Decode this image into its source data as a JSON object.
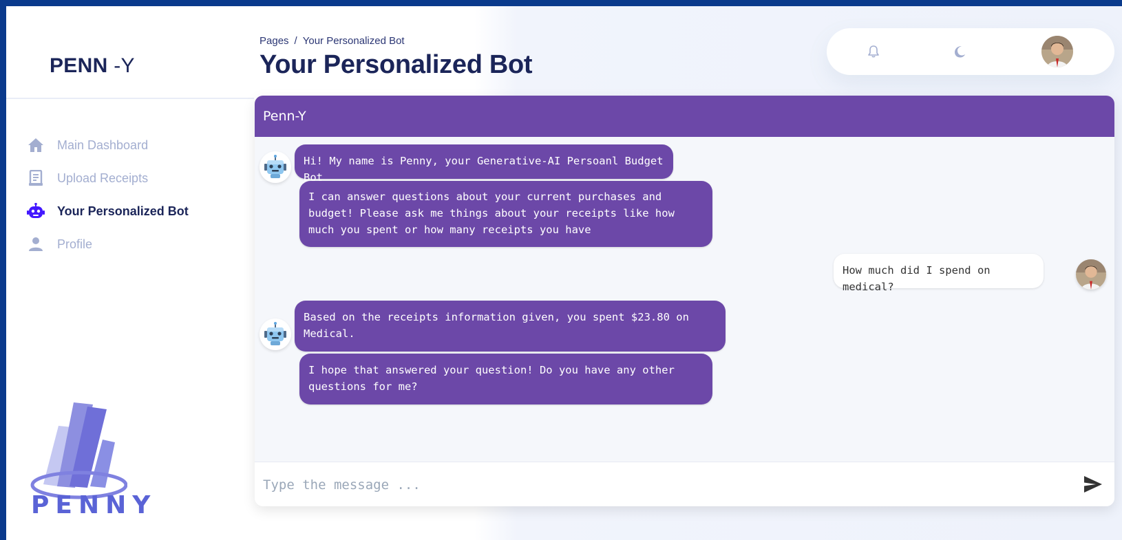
{
  "brand": {
    "bold": "PENN",
    "light": "-Y"
  },
  "sidebar": {
    "items": [
      {
        "label": "Main Dashboard",
        "icon": "home-icon",
        "active": false
      },
      {
        "label": "Upload Receipts",
        "icon": "receipt-icon",
        "active": false
      },
      {
        "label": "Your Personalized Bot",
        "icon": "robot-icon",
        "active": true
      },
      {
        "label": "Profile",
        "icon": "person-icon",
        "active": false
      }
    ],
    "logo_word": "PENNY"
  },
  "header": {
    "breadcrumb_root": "Pages",
    "breadcrumb_sep": "/",
    "breadcrumb_current": "Your Personalized Bot",
    "title": "Your Personalized Bot"
  },
  "topbar": {
    "icons": [
      "bell-icon",
      "moon-icon",
      "avatar"
    ]
  },
  "chat": {
    "title": "Penn-Y",
    "messages": [
      {
        "sender": "bot",
        "text": "Hi! My name is Penny, your Generative-AI Persoanl Budget Bot"
      },
      {
        "sender": "bot",
        "text": "I can answer questions about your current purchases and budget! Please ask me things about your receipts like how much you spent or how many receipts you have"
      },
      {
        "sender": "user",
        "text": "How much did I spend on medical?"
      },
      {
        "sender": "bot",
        "text": "Based on the receipts information given, you spent $23.80 on Medical."
      },
      {
        "sender": "bot",
        "text": "I hope that answered your question! Do you have any other questions for me?"
      }
    ],
    "input_placeholder": "Type the message ..."
  },
  "colors": {
    "accent": "#6c48a8",
    "title": "#1b2559",
    "nav_inactive": "#a3aed0",
    "nav_active_icon": "#4318ff",
    "frame": "#0a3a8c"
  }
}
